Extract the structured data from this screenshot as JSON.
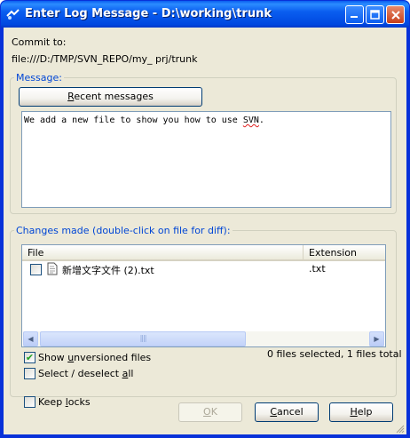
{
  "window": {
    "title": "Enter Log Message - D:\\working\\trunk",
    "title_icon": "tortoise-svn-icon"
  },
  "commit": {
    "label": "Commit to:",
    "url": "file:///D:/TMP/SVN_REPO/my_ prj/trunk"
  },
  "message_group": {
    "legend": "Message:",
    "recent_button_pre": "",
    "recent_button_key": "R",
    "recent_button_post": "ecent messages",
    "text_before": "We add a new file to show you how to use ",
    "text_misspelled": "SVN",
    "text_after": "."
  },
  "changes_group": {
    "legend": "Changes made (double-click on file for diff):",
    "columns": [
      "File",
      "Extension"
    ],
    "rows": [
      {
        "checked": false,
        "file": "新增文字文件 (2).txt",
        "extension": ".txt",
        "icon": "text-file-icon"
      }
    ],
    "status": "0 files selected, 1 files total"
  },
  "options": {
    "show_unversioned_pre": "Show ",
    "show_unversioned_key": "u",
    "show_unversioned_post": "nversioned files",
    "show_unversioned_checked": true,
    "select_all_pre": "Select / deselect ",
    "select_all_key": "a",
    "select_all_post": "ll",
    "select_all_checked": false,
    "keep_locks_pre": "Keep ",
    "keep_locks_key": "l",
    "keep_locks_post": "ocks",
    "keep_locks_checked": false
  },
  "buttons": {
    "ok_key": "O",
    "ok_post": "K",
    "cancel_pre": "",
    "cancel_key": "C",
    "cancel_post": "ancel",
    "help_key": "H",
    "help_post": "elp"
  },
  "colors": {
    "titlebar": "#0a5ef0",
    "legend": "#0046d5",
    "dialog_bg": "#ece9d8"
  }
}
